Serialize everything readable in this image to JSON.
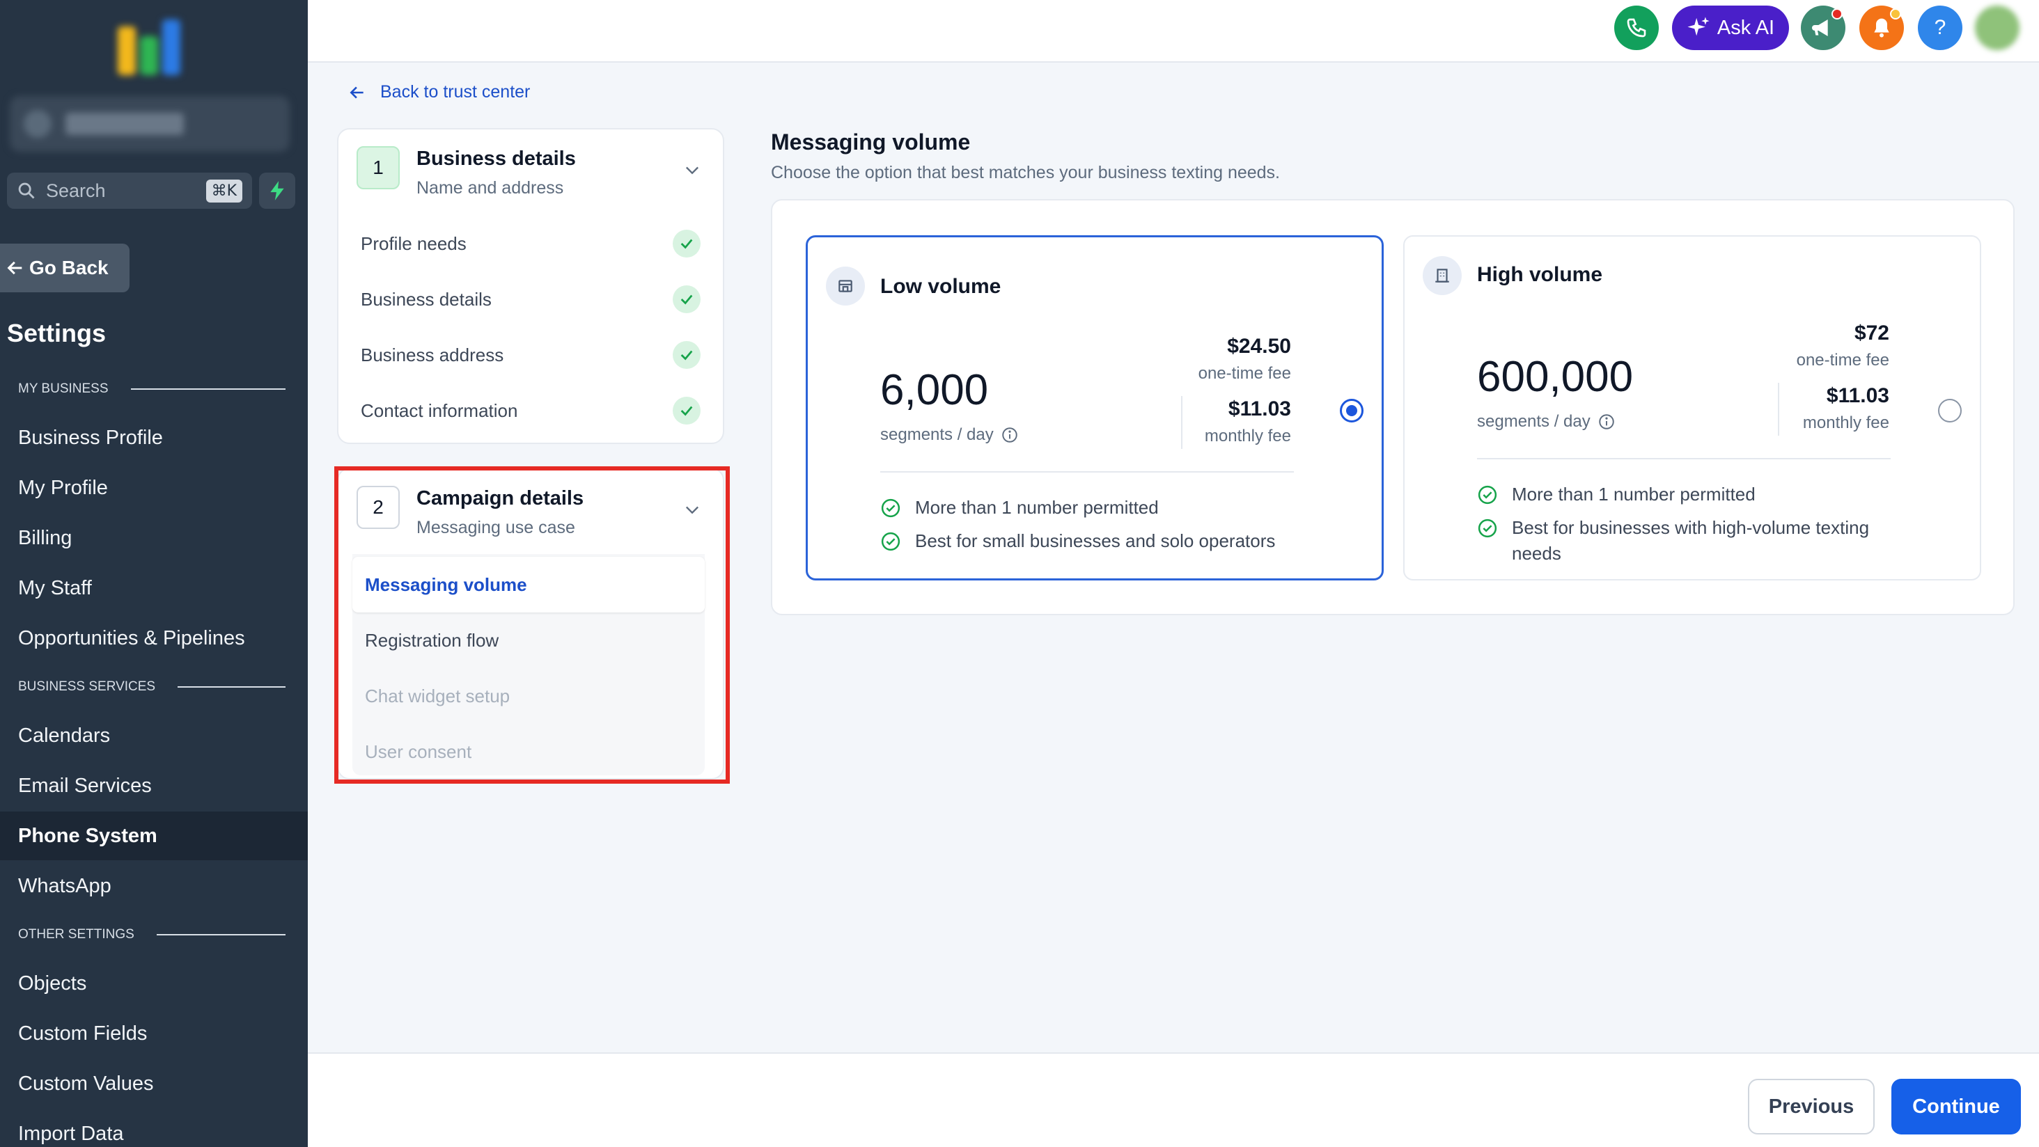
{
  "sidebar": {
    "search_label": "Search",
    "search_shortcut": "⌘K",
    "go_back": "Go Back",
    "settings_title": "Settings",
    "sections": {
      "my_business": "MY BUSINESS",
      "business_services": "BUSINESS SERVICES",
      "other_settings": "OTHER SETTINGS"
    },
    "items": [
      {
        "label": "Business Profile"
      },
      {
        "label": "My Profile"
      },
      {
        "label": "Billing"
      },
      {
        "label": "My Staff"
      },
      {
        "label": "Opportunities & Pipelines"
      },
      {
        "label": "Calendars"
      },
      {
        "label": "Email Services"
      },
      {
        "label": "Phone System",
        "active": true
      },
      {
        "label": "WhatsApp"
      },
      {
        "label": "Objects"
      },
      {
        "label": "Custom Fields"
      },
      {
        "label": "Custom Values"
      },
      {
        "label": "Import Data"
      }
    ]
  },
  "topbar": {
    "ask_ai": "Ask AI",
    "help": "?",
    "colors": {
      "phone": "#12a05c",
      "ask_ai": "#4a1fc9",
      "announce": "#3d8a72",
      "notify": "#f47317",
      "help": "#2f86ea"
    }
  },
  "back_link": "Back to trust center",
  "steps": [
    {
      "number": "1",
      "title": "Business details",
      "subtitle": "Name and address",
      "substeps": [
        {
          "label": "Profile needs",
          "done": true
        },
        {
          "label": "Business details",
          "done": true
        },
        {
          "label": "Business address",
          "done": true
        },
        {
          "label": "Contact information",
          "done": true
        }
      ]
    },
    {
      "number": "2",
      "title": "Campaign details",
      "subtitle": "Messaging use case",
      "substeps": [
        {
          "label": "Messaging volume",
          "state": "active"
        },
        {
          "label": "Registration flow",
          "state": "normal"
        },
        {
          "label": "Chat widget setup",
          "state": "disabled"
        },
        {
          "label": "User consent",
          "state": "disabled"
        }
      ]
    }
  ],
  "main": {
    "title": "Messaging volume",
    "subtitle": "Choose the option that best matches your business texting needs.",
    "options": [
      {
        "title": "Low volume",
        "segments": "6,000",
        "segments_label": "segments / day",
        "one_time_price": "$24.50",
        "one_time_label": "one-time fee",
        "monthly_price": "$11.03",
        "monthly_label": "monthly fee",
        "selected": true,
        "features": [
          "More than 1 number permitted",
          "Best for small businesses and solo operators"
        ]
      },
      {
        "title": "High volume",
        "segments": "600,000",
        "segments_label": "segments / day",
        "one_time_price": "$72",
        "one_time_label": "one-time fee",
        "monthly_price": "$11.03",
        "monthly_label": "monthly fee",
        "selected": false,
        "features": [
          "More than 1 number permitted",
          "Best for businesses with high-volume texting needs"
        ]
      }
    ]
  },
  "footer": {
    "previous": "Previous",
    "continue": "Continue"
  },
  "colors": {
    "accent": "#1660e8",
    "link": "#1c4fc9",
    "success": "#16a34a",
    "highlight": "#e62a24",
    "sidebar_bg": "#263444"
  }
}
